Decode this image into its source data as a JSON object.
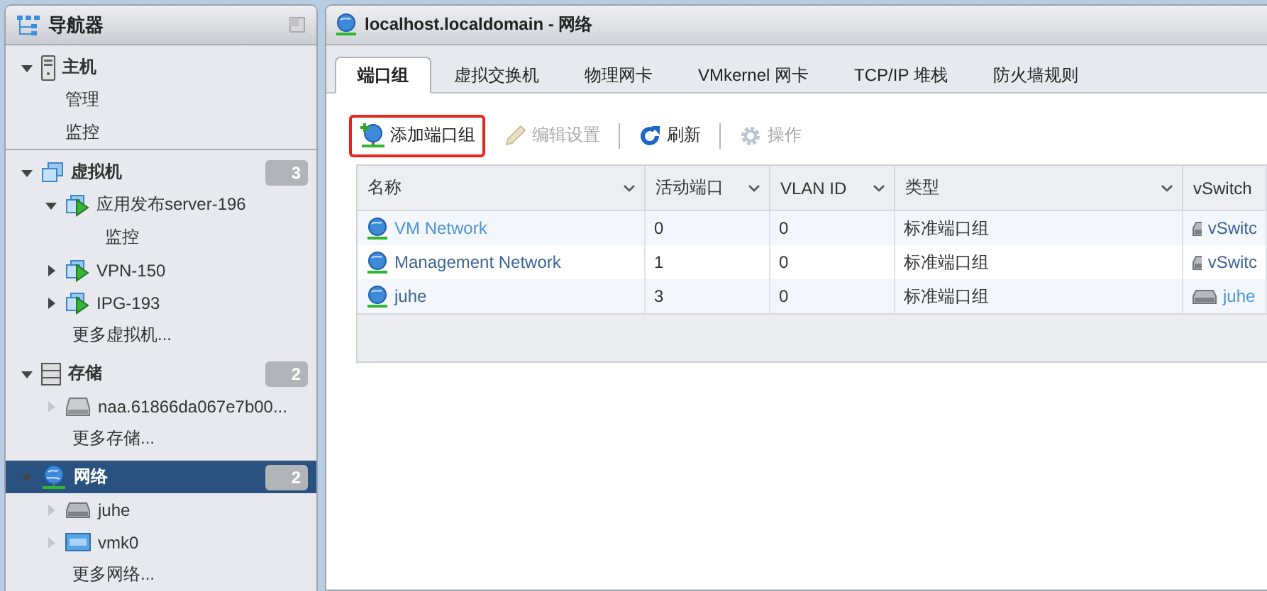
{
  "navigator": {
    "title": "导航器",
    "sections": [
      {
        "label": "主机",
        "kind": "server",
        "expanded": true,
        "selected": false,
        "children": [
          {
            "label": "管理"
          },
          {
            "label": "监控"
          }
        ]
      },
      {
        "label": "虚拟机",
        "kind": "vms",
        "expanded": true,
        "selected": false,
        "count": "3",
        "children": [
          {
            "label": "应用发布server-196",
            "kind": "vm",
            "expanded": true,
            "disabled": false,
            "children": [
              {
                "label": "监控"
              }
            ]
          },
          {
            "label": "VPN-150",
            "kind": "vm",
            "expanded": false,
            "disabled": false
          },
          {
            "label": "IPG-193",
            "kind": "vm",
            "expanded": false,
            "disabled": false
          },
          {
            "label": "更多虚拟机..."
          }
        ]
      },
      {
        "label": "存储",
        "kind": "storage",
        "expanded": true,
        "selected": false,
        "count": "2",
        "children": [
          {
            "label": "naa.61866da067e7b00...",
            "kind": "disk",
            "expanded": false,
            "disabled": true
          },
          {
            "label": "更多存储..."
          }
        ]
      },
      {
        "label": "网络",
        "kind": "network",
        "expanded": true,
        "selected": true,
        "count": "2",
        "children": [
          {
            "label": "juhe",
            "kind": "switch",
            "expanded": false,
            "disabled": true
          },
          {
            "label": "vmk0",
            "kind": "nic",
            "expanded": false,
            "disabled": true
          },
          {
            "label": "更多网络..."
          }
        ]
      }
    ]
  },
  "window": {
    "title": "localhost.localdomain - 网络"
  },
  "tabs": [
    {
      "label": "端口组",
      "selected": true
    },
    {
      "label": "虚拟交换机",
      "selected": false
    },
    {
      "label": "物理网卡",
      "selected": false
    },
    {
      "label": "VMkernel 网卡",
      "selected": false
    },
    {
      "label": "TCP/IP 堆栈",
      "selected": false
    },
    {
      "label": "防火墙规则",
      "selected": false
    }
  ],
  "toolbar": [
    {
      "label": "添加端口组",
      "kind": "add",
      "disabled": false,
      "highlighted": true
    },
    {
      "label": "编辑设置",
      "kind": "edit",
      "disabled": true,
      "highlighted": false
    },
    {
      "label": "刷新",
      "kind": "refresh",
      "disabled": false,
      "highlighted": false
    },
    {
      "label": "操作",
      "kind": "actions",
      "disabled": true,
      "highlighted": false
    }
  ],
  "table": {
    "columns": [
      "名称",
      "活动端口",
      "VLAN ID",
      "类型",
      "vSwitch"
    ],
    "rows": [
      {
        "name": "VM Network",
        "active_ports": "0",
        "vlan_id": "0",
        "type": "标准端口组",
        "vswitch": "vSwitc"
      },
      {
        "name": "Management Network",
        "active_ports": "1",
        "vlan_id": "0",
        "type": "标准端口组",
        "vswitch": "vSwitc"
      },
      {
        "name": "juhe",
        "active_ports": "3",
        "vlan_id": "0",
        "type": "标准端口组",
        "vswitch": "juhe"
      }
    ]
  }
}
